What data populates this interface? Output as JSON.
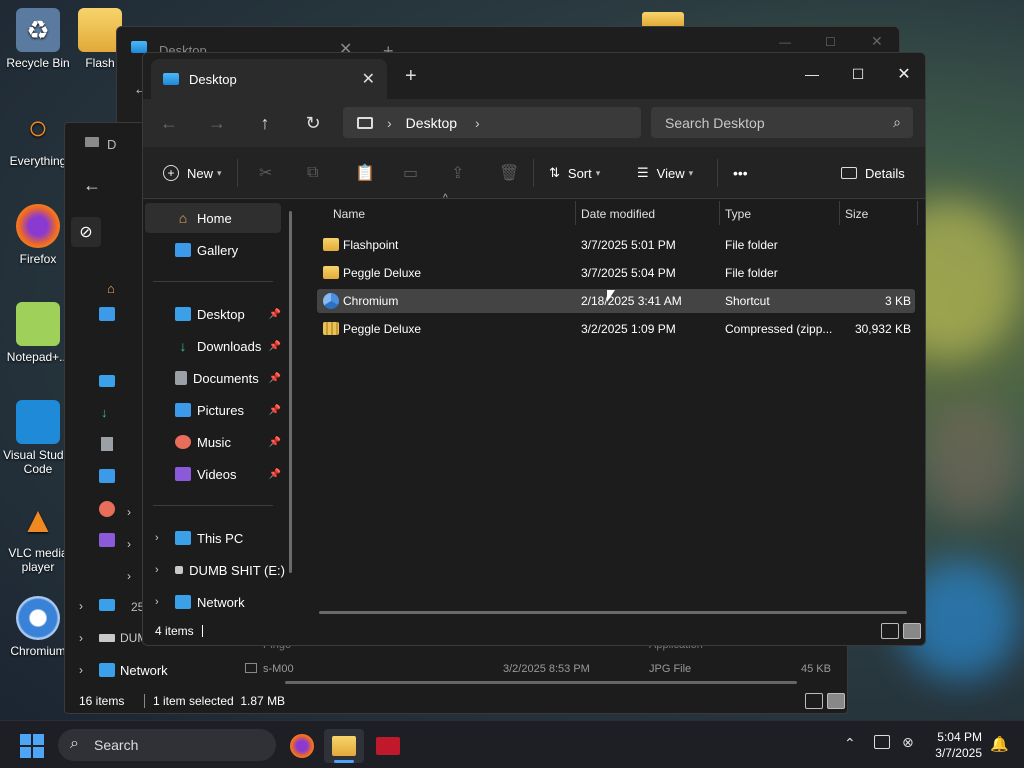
{
  "desktop_icons": [
    {
      "label": "Recycle Bin",
      "icon": "recycle-bin-icon"
    },
    {
      "label": "Flash",
      "icon": "folder-icon"
    },
    {
      "label": "Everything",
      "icon": "everything-icon"
    },
    {
      "label": "Firefox",
      "icon": "firefox-icon"
    },
    {
      "label": "Notepad+...",
      "icon": "notepad-plus-icon"
    },
    {
      "label": "Visual Studio Code",
      "icon": "vscode-icon"
    },
    {
      "label": "VLC media player",
      "icon": "vlc-icon"
    },
    {
      "label": "Chromium",
      "icon": "chromium-icon"
    }
  ],
  "back_window": {
    "tab_title": "Desktop",
    "sidebar_items": [
      "Desktop",
      "This PC",
      "DUMB SHIT (E:)",
      "Network"
    ],
    "status": {
      "count": "16 items",
      "selected": "1 item selected  1.87 MB"
    },
    "visible_rows": [
      {
        "name": "Pingo",
        "type": "Application"
      },
      {
        "name": "s-M00",
        "date": "3/2/2025 8:53 PM",
        "type": "JPG File",
        "size": "45 KB"
      }
    ],
    "partial_label": "25"
  },
  "window": {
    "tab_title": "Desktop",
    "new_tab": "+",
    "address": {
      "root_icon": "this-pc-icon",
      "path": "Desktop"
    },
    "search_placeholder": "Search Desktop",
    "toolbar": {
      "new": "New",
      "sort": "Sort",
      "view": "View",
      "more": "•••",
      "details": "Details"
    },
    "sidebar": {
      "home": "Home",
      "gallery": "Gallery",
      "quick": [
        {
          "label": "Desktop",
          "icon": "desktop-icon",
          "color": "#3aa0e8"
        },
        {
          "label": "Downloads",
          "icon": "downloads-icon",
          "color": "#35c28a"
        },
        {
          "label": "Documents",
          "icon": "documents-icon",
          "color": "#9aa0a6"
        },
        {
          "label": "Pictures",
          "icon": "pictures-icon",
          "color": "#3d9ae8"
        },
        {
          "label": "Music",
          "icon": "music-icon",
          "color": "#e86d5a"
        },
        {
          "label": "Videos",
          "icon": "videos-icon",
          "color": "#8a5ad8"
        }
      ],
      "locations": [
        "This PC",
        "DUMB SHIT (E:)",
        "Network"
      ]
    },
    "columns": {
      "name": "Name",
      "date": "Date modified",
      "type": "Type",
      "size": "Size"
    },
    "rows": [
      {
        "name": "Flashpoint",
        "date": "3/7/2025 5:01 PM",
        "type": "File folder",
        "size": "",
        "kind": "folder"
      },
      {
        "name": "Peggle Deluxe",
        "date": "3/7/2025 5:04 PM",
        "type": "File folder",
        "size": "",
        "kind": "folder"
      },
      {
        "name": "Chromium",
        "date": "2/18/2025 3:41 AM",
        "type": "Shortcut",
        "size": "3 KB",
        "kind": "shortcut"
      },
      {
        "name": "Peggle Deluxe",
        "date": "3/2/2025 1:09 PM",
        "type": "Compressed (zipp...",
        "size": "30,932 KB",
        "kind": "zip"
      }
    ],
    "status": "4 items"
  },
  "taskbar": {
    "search_label": "Search",
    "apps": [
      "firefox-icon",
      "file-explorer-icon",
      "terminal-app-icon"
    ],
    "time": "5:04 PM",
    "date": "3/7/2025"
  }
}
